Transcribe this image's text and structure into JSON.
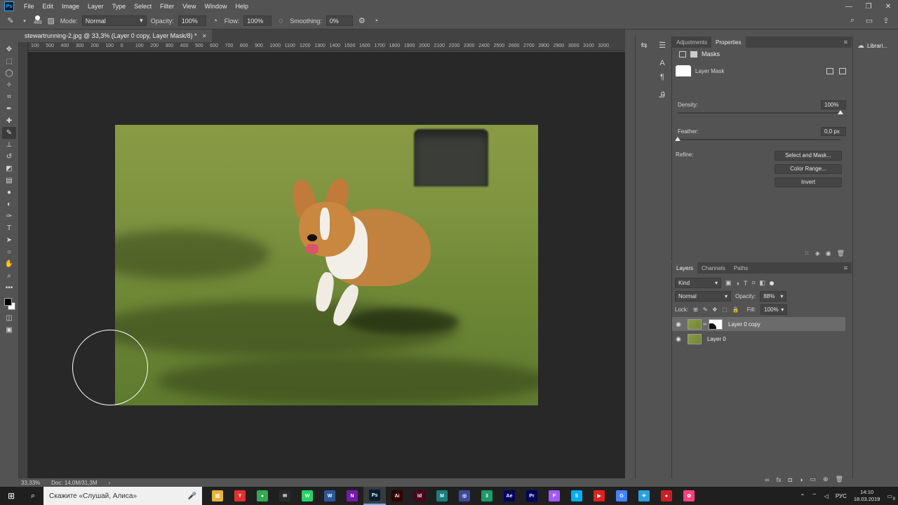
{
  "menubar": {
    "logo": "Ps",
    "items": [
      "File",
      "Edit",
      "Image",
      "Layer",
      "Type",
      "Select",
      "Filter",
      "View",
      "Window",
      "Help"
    ],
    "controls": [
      "—",
      "❐",
      "✕"
    ]
  },
  "options": {
    "brush_size": "489",
    "mode_label": "Mode:",
    "mode_value": "Normal",
    "opacity_label": "Opacity:",
    "opacity_value": "100%",
    "flow_label": "Flow:",
    "flow_value": "100%",
    "smoothing_label": "Smoothing:",
    "smoothing_value": "0%"
  },
  "document": {
    "tab_title": "stewartrunning-2.jpg @ 33,3% (Layer 0 copy, Layer Mask/8) *",
    "close": "×"
  },
  "ruler": {
    "labels": [
      "100",
      "500",
      "400",
      "300",
      "200",
      "100",
      "0",
      "100",
      "200",
      "300",
      "400",
      "500",
      "600",
      "700",
      "800",
      "900",
      "1000",
      "1100",
      "1200",
      "1300",
      "1400",
      "1500",
      "1600",
      "1700",
      "1800",
      "1900",
      "2000",
      "2100",
      "2200",
      "2300",
      "2400",
      "2500",
      "2600",
      "2700",
      "2800",
      "2900",
      "3000",
      "3100",
      "3200"
    ]
  },
  "properties": {
    "tabs": [
      "Adjustments",
      "Properties"
    ],
    "active_tab": "Properties",
    "section_title": "Masks",
    "mask_label": "Layer Mask",
    "density_label": "Density:",
    "density_value": "100%",
    "density_level": 1.0,
    "feather_label": "Feather:",
    "feather_value": "0,0 px",
    "feather_level": 0.0,
    "refine_label": "Refine:",
    "buttons": [
      "Select and Mask...",
      "Color Range...",
      "Invert"
    ]
  },
  "layers": {
    "tabs": [
      "Layers",
      "Channels",
      "Paths"
    ],
    "active_tab": "Layers",
    "kind_label": "Kind",
    "blend_mode": "Normal",
    "opacity_label": "Opacity:",
    "opacity_value": "88%",
    "lock_label": "Lock:",
    "fill_label": "Fill:",
    "fill_value": "100%",
    "items": [
      {
        "name": "Layer 0 copy",
        "selected": true,
        "has_mask": true
      },
      {
        "name": "Layer 0",
        "selected": false,
        "has_mask": false
      }
    ]
  },
  "libraries": {
    "label": "Librari..."
  },
  "status": {
    "zoom": "33,33%",
    "doc": "Doc: 14,0M/31,3M",
    "arrow": "›"
  },
  "taskbar": {
    "search_placeholder": "Скажите «Слушай, Алиса»",
    "apps": [
      {
        "label": "▤",
        "color": "#e8b339"
      },
      {
        "label": "Y",
        "color": "#e03030"
      },
      {
        "label": "●",
        "color": "#34a853"
      },
      {
        "label": "✉",
        "color": "#2a2a2a"
      },
      {
        "label": "W",
        "color": "#25d366"
      },
      {
        "label": "W",
        "color": "#2b579a"
      },
      {
        "label": "N",
        "color": "#7719aa"
      },
      {
        "label": "Ps",
        "color": "#001e36"
      },
      {
        "label": "Ai",
        "color": "#330000"
      },
      {
        "label": "Id",
        "color": "#49021f"
      },
      {
        "label": "M",
        "color": "#1a7e7e"
      },
      {
        "label": "◎",
        "color": "#3b4a9a"
      },
      {
        "label": "3",
        "color": "#1d9a6c"
      },
      {
        "label": "Ae",
        "color": "#00005b"
      },
      {
        "label": "Pr",
        "color": "#00005b"
      },
      {
        "label": "F",
        "color": "#a259ff"
      },
      {
        "label": "S",
        "color": "#00aff0"
      },
      {
        "label": "▶",
        "color": "#e02020"
      },
      {
        "label": "G",
        "color": "#4285f4"
      },
      {
        "label": "✈",
        "color": "#2aa1da"
      },
      {
        "label": "●",
        "color": "#cc1f1f"
      },
      {
        "label": "✿",
        "color": "#ff4081"
      }
    ],
    "tray_lang": "РУС",
    "time": "14:10",
    "date": "18.03.2019",
    "notification": "9"
  }
}
